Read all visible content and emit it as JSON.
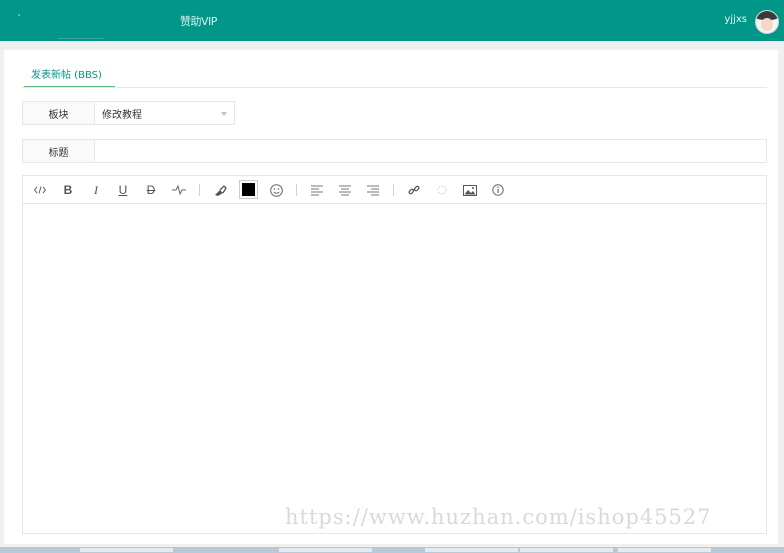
{
  "header": {
    "nav_vip": "赞助VIP",
    "username": "yjjxs"
  },
  "tabs": [
    {
      "label": "发表新帖 (BBS)",
      "active": true
    }
  ],
  "form": {
    "board_label": "板块",
    "board_value": "修改教程",
    "title_label": "标题",
    "title_value": ""
  },
  "editor": {
    "toolbar": [
      "code-icon",
      "bold-icon",
      "italic-icon",
      "underline-icon",
      "strikethrough-icon",
      "hr-icon",
      "clear-format-icon",
      "color-picker",
      "emoji-icon",
      "align-left-icon",
      "align-center-icon",
      "align-right-icon",
      "link-icon",
      "unlink-icon",
      "image-icon",
      "help-icon"
    ],
    "text_color": "#000000",
    "content": ""
  },
  "watermark": "https://www.huzhan.com/ishop45527",
  "colors": {
    "primary": "#009688",
    "tab_underline": "#5fb878"
  }
}
